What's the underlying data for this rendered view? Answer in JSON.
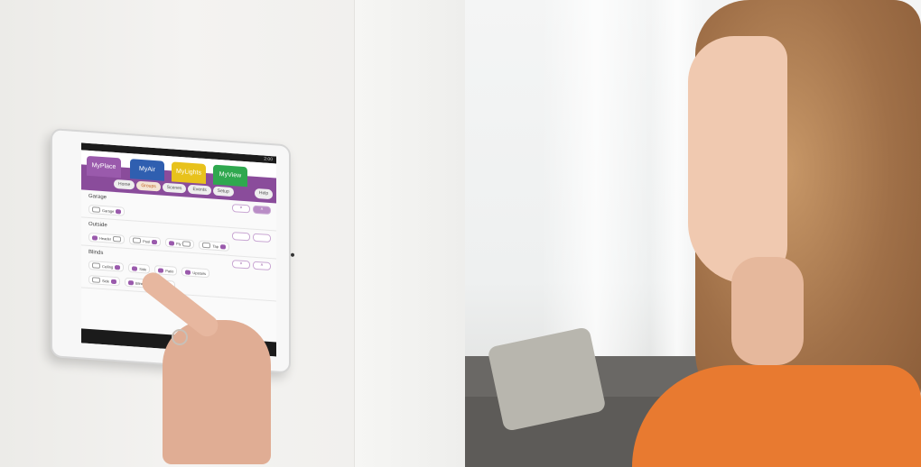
{
  "tablet_ui": {
    "status_time": "2:00",
    "app_tabs": [
      "MyPlace",
      "MyAir",
      "MyLights",
      "MyView"
    ],
    "nav_items": [
      "Home",
      "Groups",
      "Scenes",
      "Events",
      "Setup"
    ],
    "active_nav": "Groups",
    "help_label": "Help",
    "sections": [
      {
        "title": "Garage",
        "items": [
          "Garage"
        ]
      },
      {
        "title": "Outside",
        "items": [
          "Header",
          "Pool",
          "Fly",
          "Tap"
        ]
      },
      {
        "title": "Blinds",
        "items": [
          "Ceiling",
          "Side",
          "Side",
          "Patio",
          "Blind",
          "Pump",
          "Upstairs"
        ]
      }
    ],
    "nav_bar_glyph": "◁",
    "accent_color": "#8a4c9b"
  }
}
